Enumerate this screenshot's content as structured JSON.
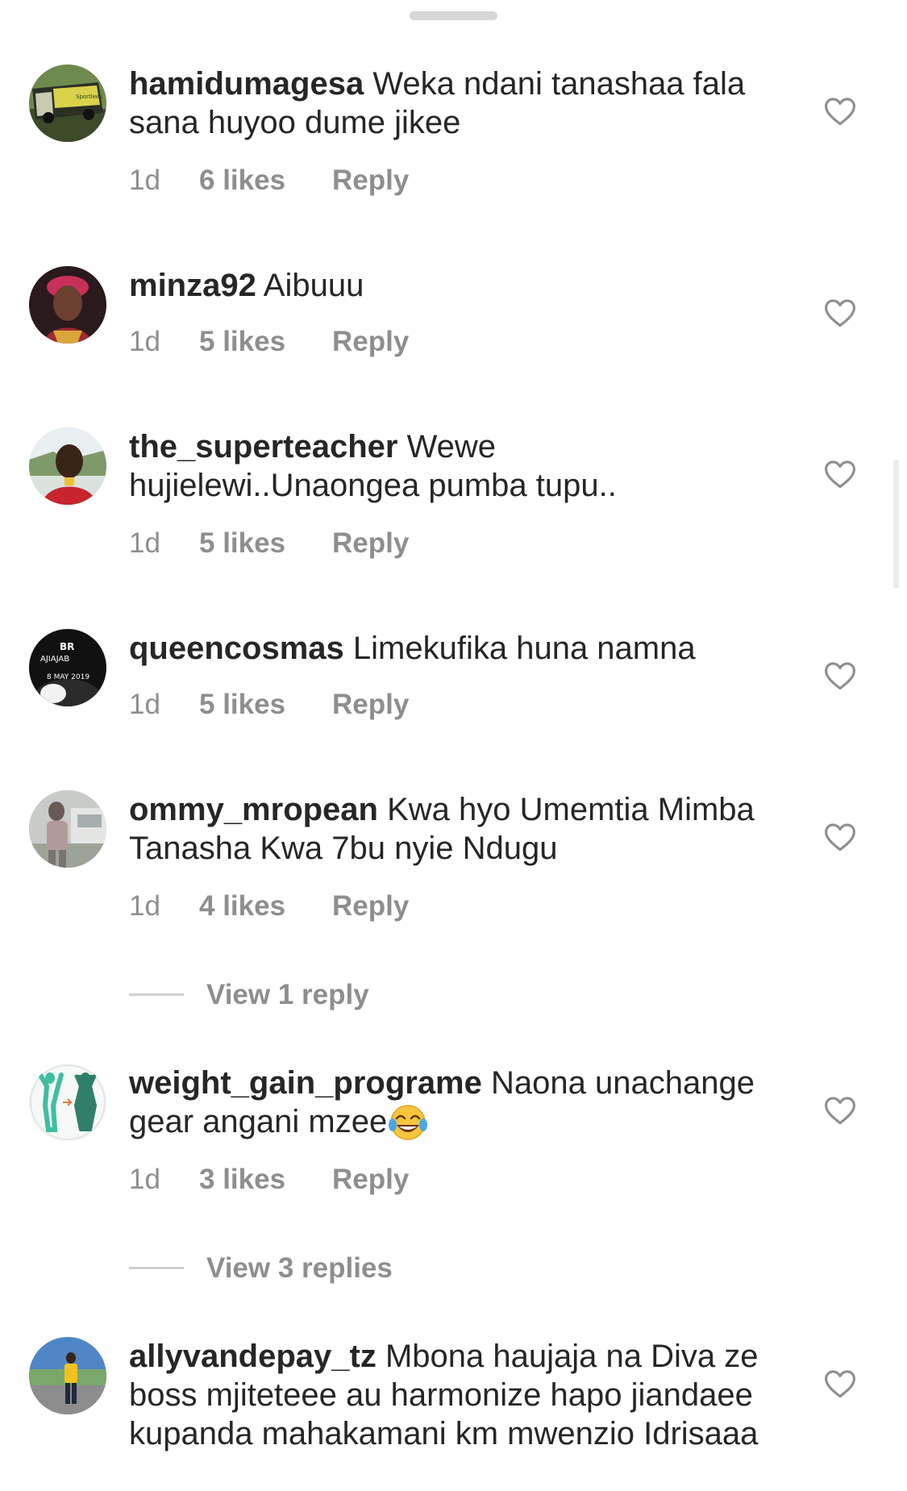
{
  "comments": [
    {
      "username": "hamidumagesa",
      "text": "Weka ndani tanashaa fala sana huyoo dume jikee",
      "time": "1d",
      "likes": "6 likes",
      "reply": "Reply"
    },
    {
      "username": "minza92",
      "text": "Aibuuu",
      "time": "1d",
      "likes": "5 likes",
      "reply": "Reply"
    },
    {
      "username": "the_superteacher",
      "text": "Wewe hujielewi..Unaongea pumba tupu..",
      "time": "1d",
      "likes": "5 likes",
      "reply": "Reply"
    },
    {
      "username": "queencosmas",
      "text": "Limekufika huna namna",
      "time": "1d",
      "likes": "5 likes",
      "reply": "Reply"
    },
    {
      "username": "ommy_mropean",
      "text": "Kwa hyo Umemtia Mimba Tanasha Kwa 7bu nyie Ndugu",
      "time": "1d",
      "likes": "4 likes",
      "reply": "Reply",
      "view_replies": "View 1 reply"
    },
    {
      "username": "weight_gain_programe",
      "text": "Naona unachange gear angani mzee",
      "emoji": "face-with-tears-of-joy",
      "time": "1d",
      "likes": "3 likes",
      "reply": "Reply",
      "view_replies": "View 3 replies"
    },
    {
      "username": "allyvandepay_tz",
      "text": "Mbona haujaja na Diva ze boss mjiteteee au harmonize hapo jiandaee kupanda mahakamani km mwenzio Idrisaaa"
    }
  ],
  "avatar_texts": {
    "queencosmas_line1": "BR",
    "queencosmas_line2": "AJIAJAB",
    "queencosmas_date": "8 MAY 2019",
    "hamidumagesa_bus": "Sportlees"
  },
  "icons": {
    "like": "heart-outline-icon"
  },
  "colors": {
    "text": "#262626",
    "secondary": "#8e8e8e",
    "divider": "#cfcfcf"
  }
}
